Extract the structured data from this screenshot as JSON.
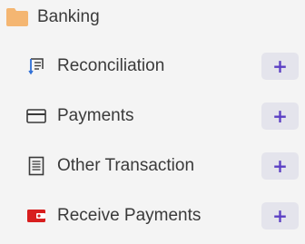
{
  "section": {
    "title": "Banking",
    "icon": "folder-icon",
    "icon_color": "#f4b672"
  },
  "items": [
    {
      "label": "Reconciliation",
      "icon": "reconciliation-icon",
      "icon_color": "#2f6fd6",
      "add_label": "+"
    },
    {
      "label": "Payments",
      "icon": "card-icon",
      "icon_color": "#3a3a3a",
      "add_label": "+"
    },
    {
      "label": "Other Transaction",
      "icon": "document-icon",
      "icon_color": "#3a3a3a",
      "add_label": "+"
    },
    {
      "label": "Receive Payments",
      "icon": "wallet-icon",
      "icon_color": "#d81e1e",
      "add_label": "+"
    }
  ],
  "colors": {
    "accent": "#5b3fc4",
    "add_button_bg": "#e4e4ec",
    "background": "#f4f4f4",
    "text": "#3a3a3a"
  }
}
